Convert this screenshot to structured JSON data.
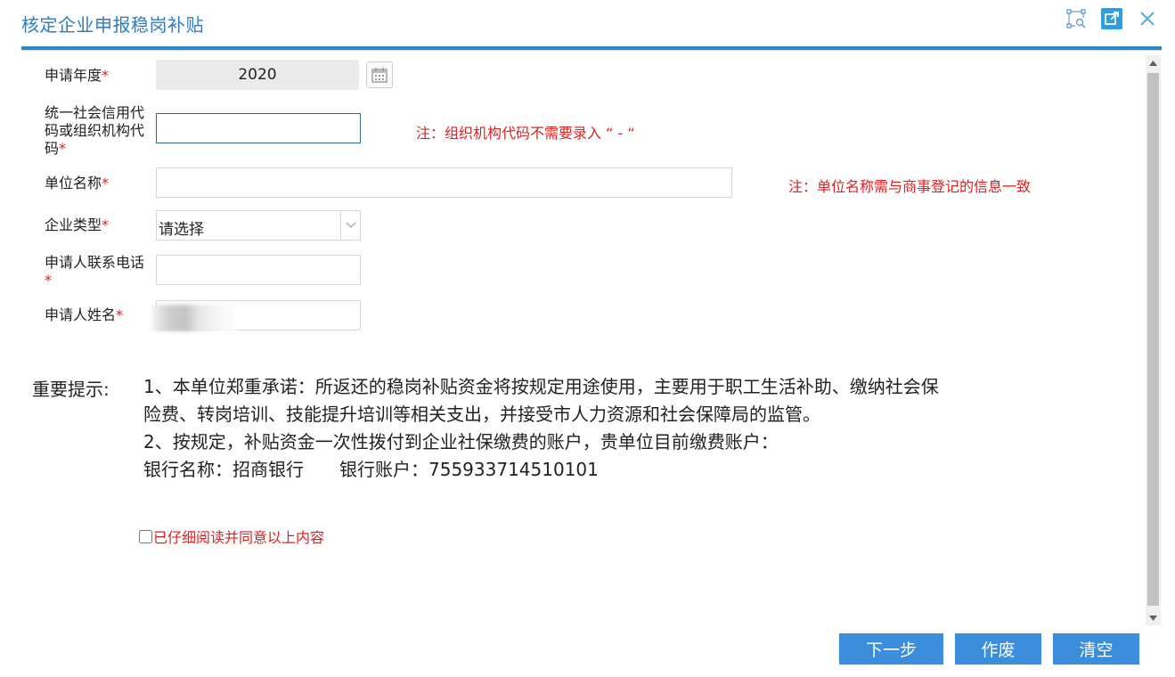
{
  "window": {
    "title": "核定企业申报稳岗补贴",
    "icons": [
      "selection-tool-icon",
      "open-external-icon",
      "close-icon"
    ]
  },
  "form": {
    "year": {
      "label": "申请年度",
      "value": "2020"
    },
    "credit_code": {
      "label": "统一社会信用代码或组织机构代码",
      "value": "",
      "note": "注：组织机构代码不需要录入 “ - “"
    },
    "unit_name": {
      "label": "单位名称",
      "value": "",
      "note": "注：单位名称需与商事登记的信息一致"
    },
    "enterprise_type": {
      "label": "企业类型",
      "selected": "请选择"
    },
    "phone": {
      "label": "申请人联系电话",
      "value": ""
    },
    "applicant_name": {
      "label": "申请人姓名",
      "value": ""
    },
    "required_mark": "*"
  },
  "tips": {
    "label": "重要提示:",
    "line1": "1、本单位郑重承诺：所返还的稳岗补贴资金将按规定用途使用，主要用于职工生活补助、缴纳社会保险费、转岗培训、技能提升培训等相关支出，并接受市人力资源和社会保障局的监管。",
    "line2": "2、按规定，补贴资金一次性拨付到企业社保缴费的账户，贵单位目前缴费账户：",
    "line3": "银行名称：招商银行　　银行账户：755933714510101"
  },
  "agreement": {
    "label": "已仔细阅读并同意以上内容",
    "checked": false
  },
  "buttons": {
    "next": "下一步",
    "void": "作废",
    "clear": "清空"
  },
  "colors": {
    "title": "#2f7dc0",
    "accent": "#3a8edb",
    "required": "#e02020",
    "line": "#2a86c8"
  }
}
